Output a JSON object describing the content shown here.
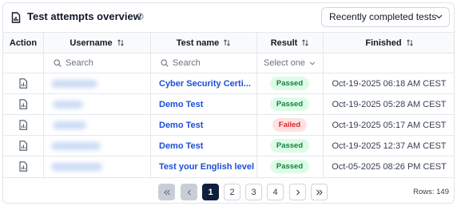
{
  "header": {
    "title": "Test attempts overview",
    "dropdown_value": "Recently completed tests"
  },
  "columns": {
    "action": "Action",
    "username": "Username",
    "test_name": "Test name",
    "result": "Result",
    "finished": "Finished"
  },
  "filters": {
    "username_placeholder": "Search",
    "test_name_placeholder": "Search",
    "result_select": "Select one"
  },
  "rows": [
    {
      "test_name": "Cyber Security Certi...",
      "result": "Passed",
      "finished": "Oct-19-2025 06:18 AM CEST"
    },
    {
      "test_name": "Demo Test",
      "result": "Passed",
      "finished": "Oct-19-2025 05:28 AM CEST"
    },
    {
      "test_name": "Demo Test",
      "result": "Failed",
      "finished": "Oct-19-2025 05:17 AM CEST"
    },
    {
      "test_name": "Demo Test",
      "result": "Passed",
      "finished": "Oct-19-2025 12:37 AM CEST"
    },
    {
      "test_name": "Test your English level",
      "result": "Passed",
      "finished": "Oct-05-2025 08:26 PM CEST"
    }
  ],
  "pagination": {
    "pages": [
      "1",
      "2",
      "3",
      "4"
    ],
    "current": "1",
    "rows_label": "Rows: 149"
  },
  "colors": {
    "link": "#1d4ed8",
    "passed_bg": "#dcfce7",
    "passed_text": "#15803d",
    "failed_bg": "#fee2e2",
    "failed_text": "#dc2626",
    "active_page": "#0f1f3d"
  },
  "icons": {
    "title": "report-chart-icon",
    "info": "info-circle-icon",
    "sort": "sort-arrows-icon",
    "search": "search-icon",
    "row_action": "report-chart-icon"
  }
}
